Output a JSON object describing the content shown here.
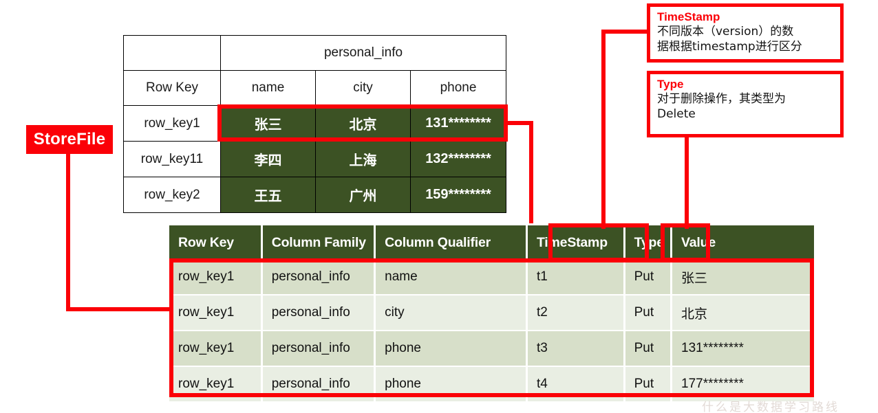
{
  "labels": {
    "storefile": "StoreFile"
  },
  "top_table": {
    "column_family": "personal_info",
    "row_key_header": "Row Key",
    "qualifiers": [
      "name",
      "city",
      "phone"
    ],
    "rows": [
      {
        "row_key": "row_key1",
        "name": "张三",
        "city": "北京",
        "phone": "131********"
      },
      {
        "row_key": "row_key11",
        "name": "李四",
        "city": "上海",
        "phone": "132********"
      },
      {
        "row_key": "row_key2",
        "name": "王五",
        "city": "广州",
        "phone": "159********"
      }
    ]
  },
  "bottom_table": {
    "headers": [
      "Row Key",
      "Column Family",
      "Column Qualifier",
      "TimeStamp",
      "Type",
      "Value"
    ],
    "rows": [
      {
        "row_key": "row_key1",
        "column_family": "personal_info",
        "column_qualifier": "name",
        "timestamp": "t1",
        "type": "Put",
        "value": "张三"
      },
      {
        "row_key": "row_key1",
        "column_family": "personal_info",
        "column_qualifier": "city",
        "timestamp": "t2",
        "type": "Put",
        "value": "北京"
      },
      {
        "row_key": "row_key1",
        "column_family": "personal_info",
        "column_qualifier": "phone",
        "timestamp": "t3",
        "type": "Put",
        "value": "131********"
      },
      {
        "row_key": "row_key1",
        "column_family": "personal_info",
        "column_qualifier": "phone",
        "timestamp": "t4",
        "type": "Put",
        "value": "177********"
      }
    ]
  },
  "callouts": {
    "timestamp": {
      "title": "TimeStamp",
      "line1": "不同版本（version）的数",
      "line2": "据根据timestamp进行区分"
    },
    "type": {
      "title": "Type",
      "line1": "对于删除操作，其类型为",
      "line2": "Delete"
    }
  },
  "watermark": "什么是大数据学习路线",
  "colors": {
    "header_green": "#3c5224",
    "row_dark": "#d7dfc9",
    "row_light": "#e9eee3",
    "annotation_red": "#fb0007"
  }
}
